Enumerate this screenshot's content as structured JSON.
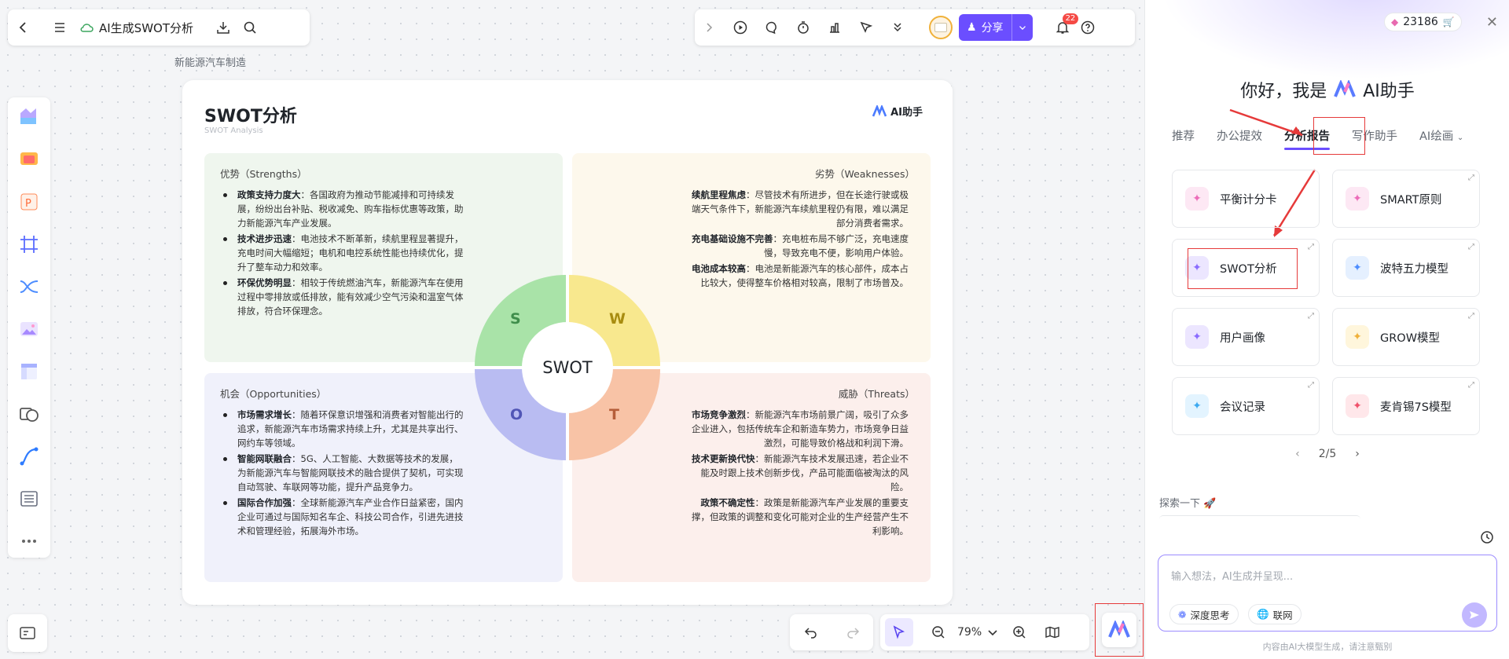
{
  "toolbar": {
    "doc_title": "AI生成SWOT分析",
    "share_label": "分享",
    "notification_count": "22"
  },
  "breadcrumb": "新能源汽车制造",
  "card": {
    "title": "SWOT分析",
    "subtitle": "SWOT Analysis",
    "ai_tag": "AI助手",
    "center_label": "SWOT",
    "wheel": {
      "s": "S",
      "w": "W",
      "o": "O",
      "t": "T"
    },
    "strengths": {
      "heading": "优势（Strengths）",
      "items": [
        {
          "k": "政策支持力度大",
          "v": "：各国政府为推动节能减排和可持续发展，纷纷出台补贴、税收减免、购车指标优惠等政策，助力新能源汽车产业发展。"
        },
        {
          "k": "技术进步迅速",
          "v": "：电池技术不断革新，续航里程显著提升，充电时间大幅缩短；电机和电控系统性能也持续优化，提升了整车动力和效率。"
        },
        {
          "k": "环保优势明显",
          "v": "：相较于传统燃油汽车，新能源汽车在使用过程中零排放或低排放，能有效减少空气污染和温室气体排放，符合环保理念。"
        }
      ]
    },
    "weaknesses": {
      "heading": "劣势（Weaknesses）",
      "items": [
        {
          "k": "续航里程焦虑",
          "v": "：尽管技术有所进步，但在长途行驶或极端天气条件下，新能源汽车续航里程仍有限，难以满足部分消费者需求。"
        },
        {
          "k": "充电基础设施不完善",
          "v": "：充电桩布局不够广泛，充电速度慢，导致充电不便，影响用户体验。"
        },
        {
          "k": "电池成本较高",
          "v": "：电池是新能源汽车的核心部件，成本占比较大，使得整车价格相对较高，限制了市场普及。"
        }
      ]
    },
    "opportunities": {
      "heading": "机会（Opportunities）",
      "items": [
        {
          "k": "市场需求增长",
          "v": "：随着环保意识增强和消费者对智能出行的追求，新能源汽车市场需求持续上升，尤其是共享出行、网约车等领域。"
        },
        {
          "k": "智能网联融合",
          "v": "：5G、人工智能、大数据等技术的发展，为新能源汽车与智能网联技术的融合提供了契机，可实现自动驾驶、车联网等功能，提升产品竞争力。"
        },
        {
          "k": "国际合作加强",
          "v": "：全球新能源汽车产业合作日益紧密，国内企业可通过与国际知名车企、科技公司合作，引进先进技术和管理经验，拓展海外市场。"
        }
      ]
    },
    "threats": {
      "heading": "威胁（Threats）",
      "items": [
        {
          "k": "市场竞争激烈",
          "v": "：新能源汽车市场前景广阔，吸引了众多企业进入，包括传统车企和新造车势力，市场竞争日益激烈，可能导致价格战和利润下滑。"
        },
        {
          "k": "技术更新换代快",
          "v": "：新能源汽车技术发展迅速，若企业不能及时跟上技术创新步伐，产品可能面临被淘汰的风险。"
        },
        {
          "k": "政策不确定性",
          "v": "：政策是新能源汽车产业发展的重要支撑，但政策的调整和变化可能对企业的生产经营产生不利影响。"
        }
      ]
    }
  },
  "bottom_bar": {
    "zoom": "79%"
  },
  "panel": {
    "credits": "23186",
    "greeting": "你好，我是",
    "assistant_name": "AI助手",
    "tabs": [
      "推荐",
      "办公提效",
      "分析报告",
      "写作助手",
      "AI绘画"
    ],
    "templates": [
      "平衡计分卡",
      "SMART原则",
      "SWOT分析",
      "波特五力模型",
      "用户画像",
      "GROW模型",
      "会议记录",
      "麦肯锡7S模型"
    ],
    "pager": "2/5",
    "explore": "探索一下",
    "input_placeholder": "输入想法，AI生成并呈现...",
    "chip_deep": "深度思考",
    "chip_web": "联网",
    "disclaimer": "内容由AI大模型生成，请注意甄别"
  },
  "colors": {
    "accent": "#6b4eff",
    "highlight": "#e63a3a",
    "s": "#a9e3a8",
    "w": "#f8e88e",
    "o": "#b9bcf2",
    "t": "#f8c3a6"
  }
}
